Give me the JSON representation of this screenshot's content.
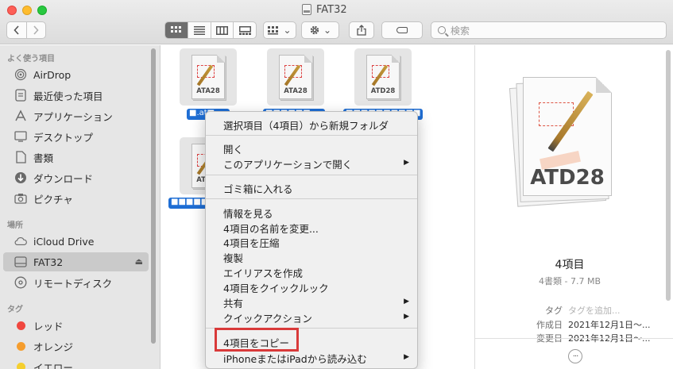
{
  "window": {
    "title": "FAT32"
  },
  "toolbar": {
    "back_icon": "chevron-left",
    "forward_icon": "chevron-right",
    "view_modes": [
      "icon",
      "list",
      "column",
      "gallery"
    ],
    "action_caret": "⌄",
    "search_placeholder": "検索"
  },
  "sidebar": {
    "favorites_header": "よく使う項目",
    "favorites": [
      {
        "label": "AirDrop",
        "icon": "airdrop-icon"
      },
      {
        "label": "最近使った項目",
        "icon": "recents-icon"
      },
      {
        "label": "アプリケーション",
        "icon": "applications-icon"
      },
      {
        "label": "デスクトップ",
        "icon": "desktop-icon"
      },
      {
        "label": "書類",
        "icon": "documents-icon"
      },
      {
        "label": "ダウンロード",
        "icon": "downloads-icon"
      },
      {
        "label": "ピクチャ",
        "icon": "pictures-icon"
      }
    ],
    "locations_header": "場所",
    "locations": [
      {
        "label": "iCloud Drive",
        "icon": "cloud-icon"
      },
      {
        "label": "FAT32",
        "icon": "drive-icon",
        "selected": true
      },
      {
        "label": "リモートディスク",
        "icon": "remote-disc-icon"
      }
    ],
    "tags_header": "タグ",
    "tags": [
      {
        "label": "レッド",
        "color": "#f0473f"
      },
      {
        "label": "オレンジ",
        "color": "#f59d2e"
      },
      {
        "label": "イエロー",
        "color": "#f5cf2f"
      }
    ]
  },
  "files": [
    {
      "icon_label": "ATA28",
      "name": "■.at■"
    },
    {
      "icon_label": "ATA28",
      "name": "■■■■■■"
    },
    {
      "icon_label": "ATD28",
      "name": "■■■■■■■■■■"
    },
    {
      "icon_label": "ATA28",
      "name": "■■■■■■■"
    }
  ],
  "preview": {
    "icon_label": "ATD28",
    "title": "4項目",
    "subtitle": "4書類 - 7.7 MB",
    "tag_key": "タグ",
    "tag_placeholder": "タグを追加...",
    "created_key": "作成日",
    "created_value": "2021年12月1日〜...",
    "modified_key": "変更日",
    "modified_value": "2021年12月1日〜...",
    "more_label": "···"
  },
  "context_menu": {
    "items": [
      "選択項目（4項目）から新規フォルダ",
      "開く",
      "このアプリケーションで開く",
      "ゴミ箱に入れる",
      "情報を見る",
      "4項目の名前を変更...",
      "4項目を圧縮",
      "複製",
      "エイリアスを作成",
      "4項目をクイックルック",
      "共有",
      "クイックアクション",
      "4項目をコピー",
      "iPhoneまたはiPadから読み込む"
    ],
    "submenu_arrow": "▶",
    "highlight_color": "#d93a3a"
  }
}
